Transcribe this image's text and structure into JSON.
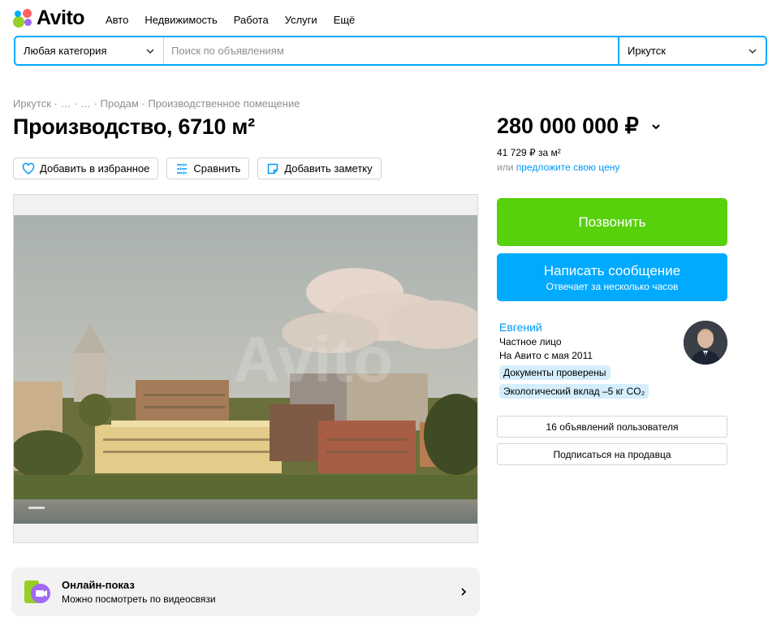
{
  "header": {
    "logo_text": "Avito",
    "nav": [
      "Авто",
      "Недвижимость",
      "Работа",
      "Услуги",
      "Ещё"
    ]
  },
  "search": {
    "category": "Любая категория",
    "placeholder": "Поиск по объявлениям",
    "city": "Иркутск"
  },
  "breadcrumb": "Иркутск · … · … · Продам · Производственное помещение",
  "listing": {
    "title": "Производство, 6710 м²",
    "actions": {
      "favorite": "Добавить в избранное",
      "compare": "Сравнить",
      "note": "Добавить заметку"
    },
    "price": "280 000 000 ₽",
    "price_per_m": "41 729 ₽ за м²",
    "offer_prefix": "или ",
    "offer_link": "предложите свою цену"
  },
  "contact": {
    "call": "Позвонить",
    "message": "Написать сообщение",
    "message_sub": "Отвечает за несколько часов"
  },
  "seller": {
    "name": "Евгений",
    "type": "Частное лицо",
    "since": "На Авито с мая 2011",
    "badges": [
      "Документы проверены",
      "Экологический вклад –5 кг CO₂"
    ],
    "ads_button": "16 объявлений пользователя",
    "subscribe_button": "Подписаться на продавца"
  },
  "online_show": {
    "title": "Онлайн-показ",
    "subtitle": "Можно посмотреть по видеосвязи"
  },
  "colors": {
    "accent_blue": "#00aaff",
    "call_green": "#58d10d",
    "link_blue": "#0099f7"
  }
}
